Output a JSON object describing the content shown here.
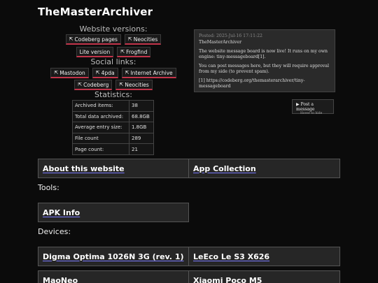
{
  "site": {
    "title": "TheMasterArchiver"
  },
  "versions": {
    "heading": "Website versions:",
    "rows": [
      [
        {
          "label": "Codeberg pages"
        },
        {
          "label": "Neocities"
        }
      ],
      [
        {
          "label": "Lite version",
          "plain": true
        },
        {
          "label": "Frogfind"
        }
      ]
    ]
  },
  "social": {
    "heading": "Social links:",
    "rows": [
      [
        {
          "label": "Mastodon"
        },
        {
          "label": "4pda"
        },
        {
          "label": "Internet Archive"
        }
      ],
      [
        {
          "label": "Codeberg"
        },
        {
          "label": "Neocities"
        }
      ]
    ]
  },
  "stats": {
    "heading": "Statistics:",
    "rows": [
      {
        "key": "Archived items:",
        "value": "38"
      },
      {
        "key": "Total data archived:",
        "value": "68.8GB"
      },
      {
        "key": "Average entry size:",
        "value": "1.8GB"
      },
      {
        "key": "File count",
        "value": "289"
      },
      {
        "key": "Page count:",
        "value": "21"
      }
    ]
  },
  "message_board": {
    "date": "Posted: 2025-Jul-16 17:11:22",
    "author": "TheMasterArchiver",
    "paragraphs": [
      "The website message board is now live! It runs on my own engine: tiny-messageboard[1].",
      "You can post messages here, but they will require approval from my side (to prevent spam).",
      "[1] https://codeberg.org/themasterarchiver/tiny-messageboard"
    ],
    "post_button": "Post a message",
    "post_hint": "Hover to hide"
  },
  "nav": {
    "about": "About this website",
    "apps": "App Collection"
  },
  "tools": {
    "heading": "Tools:",
    "items": [
      "APK Info"
    ]
  },
  "devices": {
    "heading": "Devices:",
    "items": [
      "Digma Optima 1026N 3G (rev. 1)",
      "LeEco Le S3 X626",
      "MaoNeo",
      "Xiaomi Poco M5"
    ]
  }
}
